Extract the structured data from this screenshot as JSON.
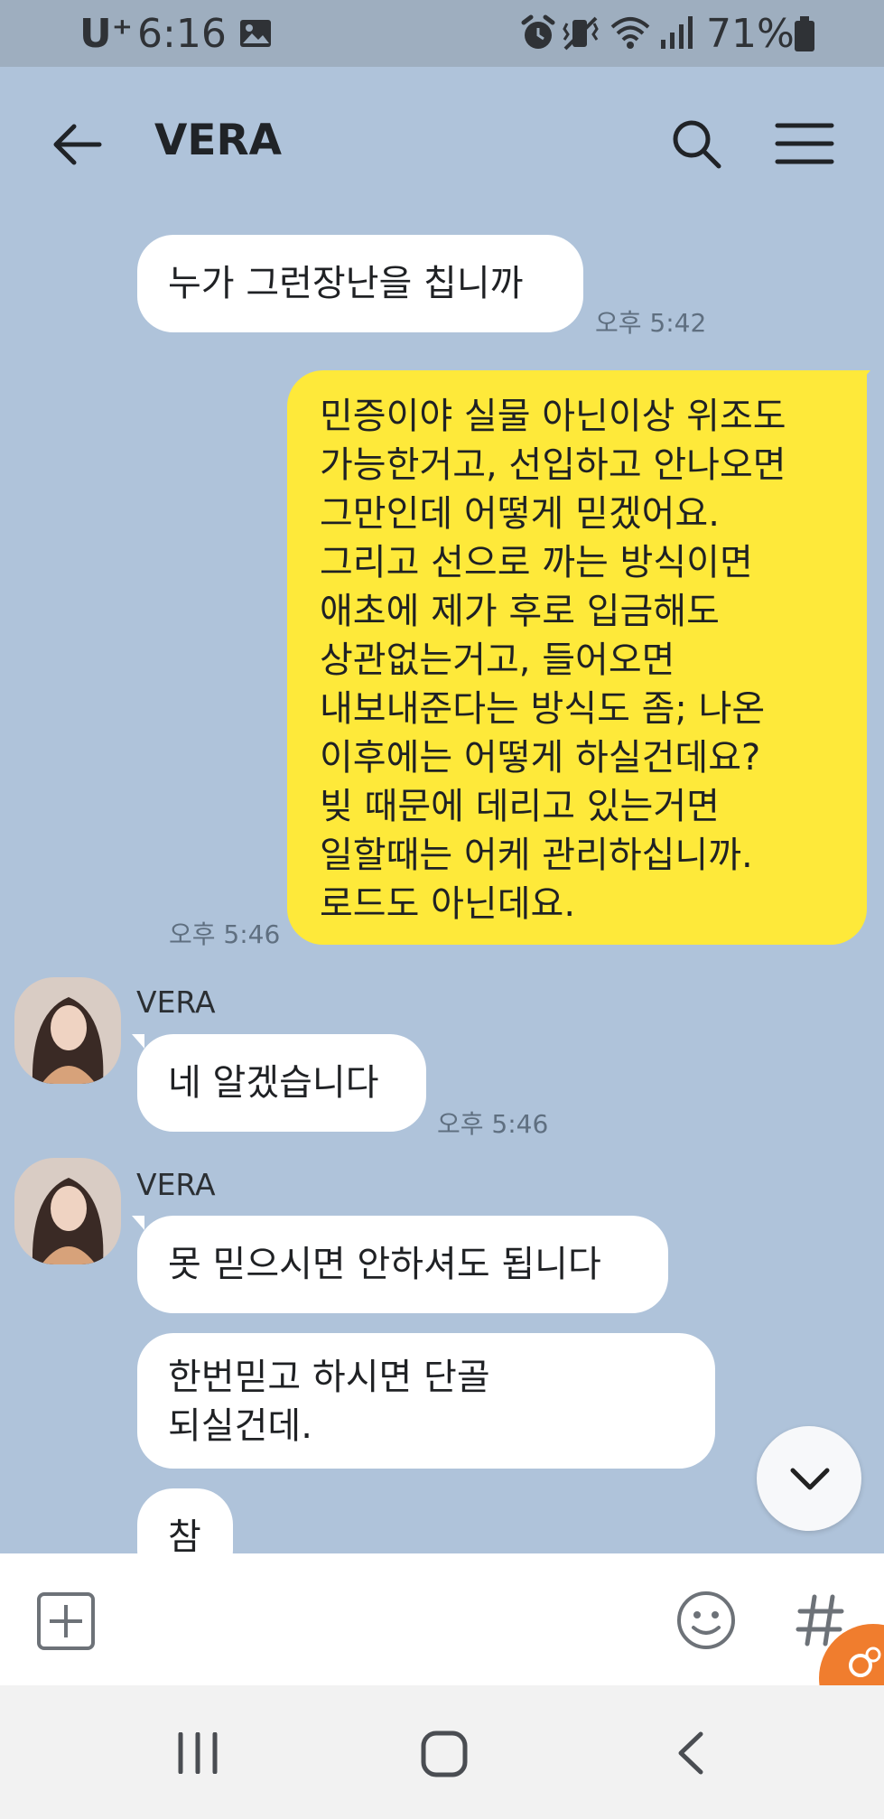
{
  "status_bar": {
    "carrier": "U⁺",
    "time": "6:16",
    "battery": "71%",
    "icons": [
      "image-icon",
      "alarm-icon",
      "vibrate-icon",
      "wifi-icon",
      "signal-icon",
      "battery-icon"
    ]
  },
  "header": {
    "title": "VERA",
    "icons": [
      "back-arrow-icon",
      "search-icon",
      "menu-icon"
    ]
  },
  "messages": [
    {
      "side": "right",
      "color": "white",
      "text": "누가 그런장난을 칩니까",
      "time": "오후 5:42"
    },
    {
      "side": "right",
      "color": "yellow",
      "lines": [
        "민증이야 실물 아닌이상 위조도",
        "가능한거고, 선입하고 안나오면",
        "그만인데 어떻게 믿겠어요.",
        "그리고 선으로 까는 방식이면",
        "애초에 제가 후로 입금해도",
        "상관없는거고, 들어오면",
        "내보내준다는 방식도 좀; 나온",
        "이후에는 어떻게 하실건데요?",
        "빚 때문에 데리고 있는거면",
        "일할때는 어케 관리하십니까.",
        "로드도 아닌데요."
      ],
      "time": "오후 5:46"
    },
    {
      "side": "left",
      "sender": "VERA",
      "text": "네 알겠습니다",
      "time": "오후 5:46"
    },
    {
      "side": "left",
      "sender": "VERA",
      "text": "못 믿으시면 안하셔도 됩니다"
    },
    {
      "side": "left",
      "lines": [
        "한번믿고 하시면 단골",
        "되실건데."
      ]
    },
    {
      "side": "left",
      "text": "참"
    }
  ],
  "input_bar": {
    "icons": [
      "add-icon",
      "emoji-icon",
      "hashtag-icon"
    ]
  },
  "nav_bar": {
    "icons": [
      "recent-apps-icon",
      "home-icon",
      "back-icon"
    ]
  },
  "colors": {
    "chat_background": "#afc3da",
    "my_bubble": "#fee93a",
    "their_bubble": "#ffffff",
    "status_bar": "#9eaebf"
  }
}
